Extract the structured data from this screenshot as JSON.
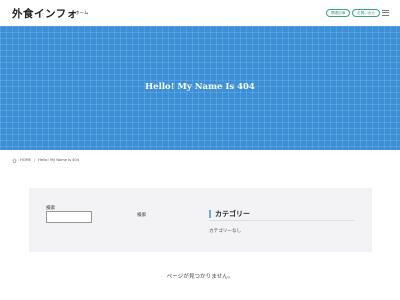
{
  "header": {
    "site_title": "外食インフォ",
    "nav_home": "ホーム",
    "pill_1": "関連記事",
    "pill_2": "お問い合せ"
  },
  "hero": {
    "title": "Hello! My Name Is 404"
  },
  "breadcrumb": {
    "home": "HOME",
    "separator": "/",
    "current": "Hello! My Name Is 404"
  },
  "widget": {
    "search_label": "検索",
    "search_value": "",
    "search_button": "検索",
    "category_title": "カテゴリー",
    "category_empty": "カテゴリーなし"
  },
  "main": {
    "not_found": "ページが見つかりません。"
  },
  "colors": {
    "hero_bg": "#3a8fd6",
    "accent_green": "#3aa37f",
    "category_bar": "#5fb3e0",
    "panel_bg": "#f3f3f5"
  },
  "icons": {
    "menu": "hamburger-menu-icon",
    "home": "home-icon"
  }
}
